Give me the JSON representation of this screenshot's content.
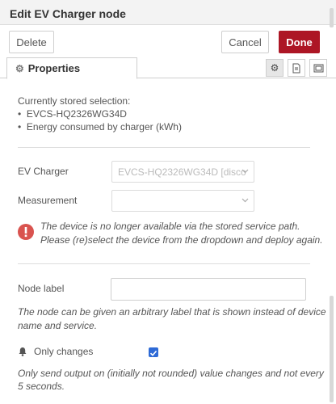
{
  "tray": {
    "title": "Edit EV Charger node",
    "delete_label": "Delete",
    "cancel_label": "Cancel",
    "done_label": "Done"
  },
  "tabs": {
    "properties_label": "Properties"
  },
  "stored": {
    "heading": "Currently stored selection:",
    "items": [
      "EVCS-HQ2326WG34D",
      "Energy consumed by charger (kWh)"
    ]
  },
  "ev_charger": {
    "label": "EV Charger",
    "value": "EVCS-HQ2326WG34D [disco"
  },
  "measurement": {
    "label": "Measurement",
    "value": ""
  },
  "error": {
    "line1": "The device is no longer available via the stored service path.",
    "line2": "Please (re)select the device from the dropdown and deploy again."
  },
  "node_label": {
    "label": "Node label",
    "value": "",
    "help_line1": "The node can be given an arbitrary label that is shown instead of device",
    "help_line2": "name and service."
  },
  "only_changes": {
    "label": "Only changes",
    "checked": true,
    "help_line1": "Only send output on (initially not rounded) value changes and not every",
    "help_line2": "5 seconds."
  },
  "colors": {
    "primary": "#ad1625",
    "error_icon": "#d9534f",
    "checkbox": "#2e6ad6"
  }
}
